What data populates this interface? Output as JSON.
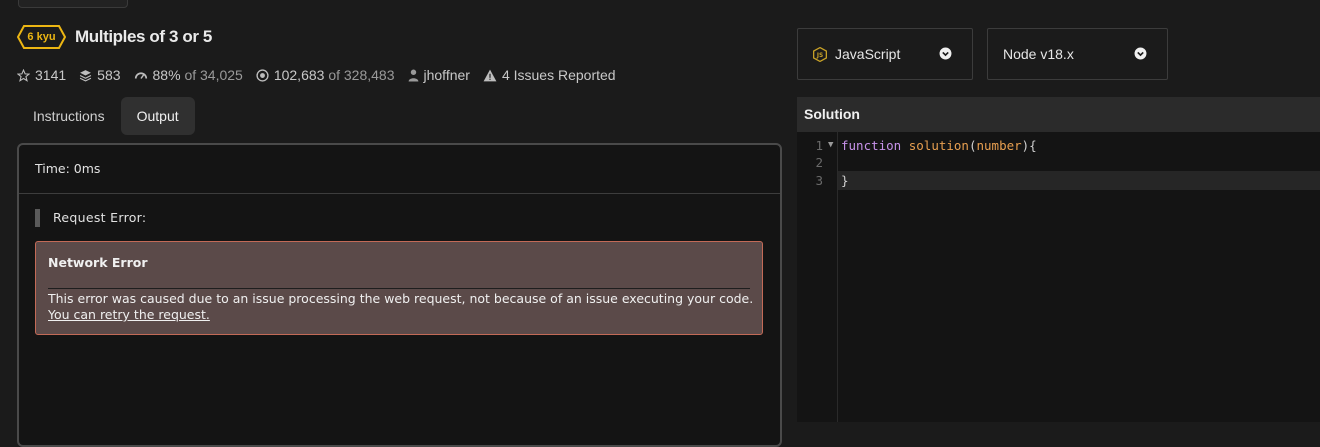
{
  "kata": {
    "rank": "6 kyu",
    "title": "Multiples of 3 or 5",
    "rank_color": "#ecb613"
  },
  "stats": {
    "stars": "3141",
    "collections": "583",
    "satisfaction": "88%",
    "satisfaction_of": "of 34,025",
    "completed": "102,683",
    "completed_of": "of 328,483",
    "author": "jhoffner",
    "issues": "4 Issues Reported"
  },
  "tabs": [
    {
      "label": "Instructions",
      "active": false
    },
    {
      "label": "Output",
      "active": true
    }
  ],
  "output": {
    "time": "Time: 0ms",
    "request_error_label": "Request Error:",
    "error_title": "Network Error",
    "error_message": "This error was caused due to an issue processing the web request, not because of an issue executing your code.",
    "retry_link": "You can retry the request."
  },
  "language_select": {
    "value": "JavaScript"
  },
  "version_select": {
    "value": "Node v18.x"
  },
  "solution": {
    "header": "Solution",
    "line_numbers": [
      "1",
      "2",
      "3"
    ],
    "code": {
      "keyword": "function",
      "fn_name": "solution",
      "open_paren": "(",
      "param": "number",
      "close_paren_brace": "){",
      "closing_brace": "}"
    }
  },
  "colors": {
    "background": "#1b1b1b",
    "error_bg": "#5b4a49",
    "error_border": "#c36a57",
    "accent_yellow": "#ecb613"
  }
}
